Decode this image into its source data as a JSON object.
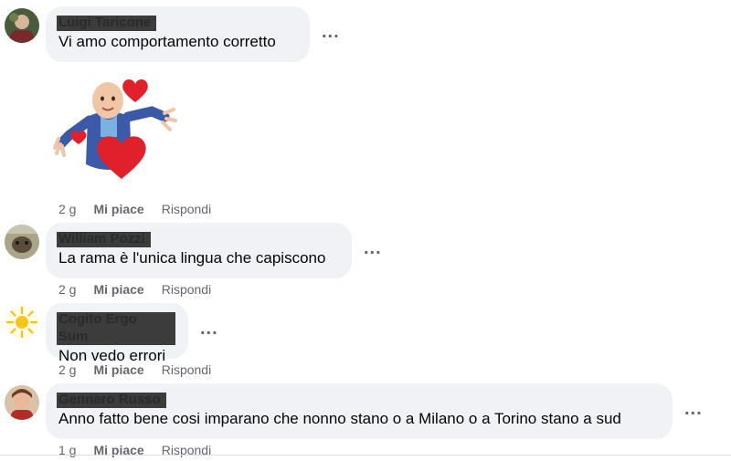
{
  "comments": [
    {
      "author": "Luigi Taricone",
      "text": "Vi amo comportamento corretto",
      "time": "2 g",
      "like_label": "Mi piace",
      "reply_label": "Rispondi",
      "more_label": "..."
    },
    {
      "author": "William Pozzi",
      "text": "La rama è l'unica lingua che capiscono",
      "time": "2 g",
      "like_label": "Mi piace",
      "reply_label": "Rispondi",
      "more_label": "..."
    },
    {
      "author": "Cogito Ergo Sum",
      "text": "Non vedo errori",
      "time": "2 g",
      "like_label": "Mi piace",
      "reply_label": "Rispondi",
      "more_label": "..."
    },
    {
      "author": "Gennaro Russo",
      "text": "Anno fatto bene cosi imparano che nonno stano o a Milano o a Torino stano a sud",
      "time": "1 g",
      "like_label": "Mi piace",
      "reply_label": "Rispondi",
      "more_label": "..."
    }
  ],
  "sticker": {
    "icon": "avatar-hearts-sticker",
    "heart_color": "#e0202a"
  }
}
